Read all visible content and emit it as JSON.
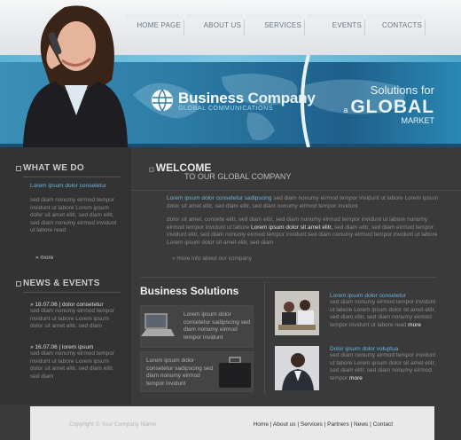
{
  "nav": {
    "items": [
      "HOME PAGE",
      "ABOUT US",
      "SERVICES",
      "EVENTS",
      "CONTACTS"
    ]
  },
  "banner": {
    "logo_title_a": "Business",
    "logo_title_b": "Company",
    "logo_sub": "GLOBAL COMMUNICATIONS",
    "slogan_1": "Solutions for",
    "slogan_2": "a",
    "slogan_3": "GLOBAL",
    "slogan_4": "MARKET"
  },
  "sidebar": {
    "what_we_do_title": "WHAT WE DO",
    "what_we_do_link": "Lorem ipsum dolor consetetur",
    "what_we_do_text": "sed diam nonumy eirmod tempor invidunt ut labore Lorem ipsum dolor sit amet elitr, sed diam elitr, sed diam nonumy eirmod invidunt ut labore read",
    "more_1": "more",
    "news_title": "NEWS & EVENTS",
    "news": [
      {
        "date": "18.07.06",
        "title": "dolor consetetur",
        "text": "sed diam nonumy eirmod tempor invidunt ut labore Lorem ipsum dolor sit amet elitr, sed diam"
      },
      {
        "date": "16.07.06",
        "title": "lorem ipsum",
        "text": "sed diam nonumy eirmod tempor invidunt ut labore Lorem ipsum dolor sit amet elitr, sed diam elitr, sed diam"
      }
    ]
  },
  "welcome": {
    "title": "WELCOME",
    "subtitle": "TO OUR GLOBAL COMPANY",
    "p1_link": "Lorem ipsum dolor consetetur sadipscing",
    "p1_text": " sed diam nonumy eirmod tempor invidunt ut labore Lorem ipsum dolor sit amet elitr, sed diam elitr, sed diam nonumy eirmod tempor invidunt",
    "p2_text_a": "dolor sit amet, consete elitr, sed diam elitr, sed diam nonumy eirmod tempor invidunt ut labore nonumy eirmod tempor invidunt ut labore ",
    "p2_strong": "Lorem ipsum dolor sit amet elitr,",
    "p2_text_b": " sed diam elitr, sed diam eirmod tempor invidunt elitr, sed diam nonumy eirmod tempor invidunt sed diam nonumy eirmod tempor invidunt ut labore Lorem ipsum dolor sit amet elitr, sed diam",
    "more_info": "more info about our company"
  },
  "business": {
    "title": "Business Solutions",
    "box1_text": "Lorem ipsum dolor consetetur sadipscing sed diam nonumy eirmod tempor invidunt",
    "box2_text": "Lorem ipsum dolor consetetur sadipscing sed diam nonumy eirmod tempor invidunt"
  },
  "right_items": [
    {
      "link": "Lorem ipsum dolor consetetur",
      "text": "sed diam nonumy eirmod tempor invidunt ut labore Lorem ipsum dolor sit amet elitr, sed diam elitr, sed diam nonumy eirmod tempor invidunt ut labore read",
      "more": "more"
    },
    {
      "link": "Dolor ipsum dolor voluptua",
      "text": "sed diam nonumy eirmod tempor invidunt ut labore Lorem ipsum dolor sit amet elitr, sed diam elitr, sed diam nonumy eirmod tempor",
      "more": "more"
    }
  ],
  "footer": {
    "copyright": "Copyright © Your Company Name",
    "links": [
      "Home",
      "About us",
      "Services",
      "Partners",
      "News",
      "Contact"
    ]
  }
}
